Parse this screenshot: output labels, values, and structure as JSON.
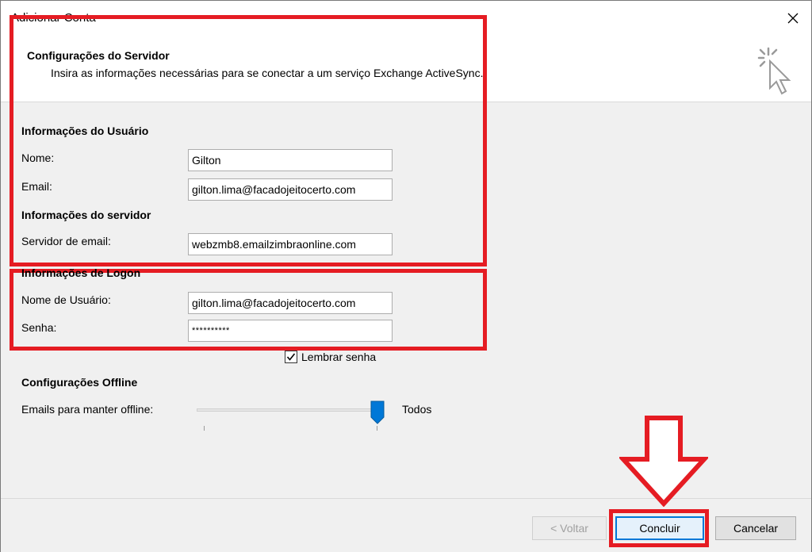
{
  "window": {
    "title": "Adicionar Conta"
  },
  "header": {
    "title": "Configurações do Servidor",
    "subtitle": "Insira as informações necessárias para se conectar a um serviço Exchange ActiveSync."
  },
  "user_info": {
    "section": "Informações do Usuário",
    "name_label": "Nome:",
    "name_value": "Gilton",
    "email_label": "Email:",
    "email_value": "gilton.lima@facadojeitocerto.com"
  },
  "server_info": {
    "section": "Informações do servidor",
    "server_label": "Servidor de email:",
    "server_value": "webzmb8.emailzimbraonline.com"
  },
  "logon_info": {
    "section": "Informações de Logon",
    "username_label": "Nome de Usuário:",
    "username_value": "gilton.lima@facadojeitocerto.com",
    "password_label": "Senha:",
    "password_value": "**********",
    "remember_label": "Lembrar senha",
    "remember_checked": true
  },
  "offline": {
    "section": "Configurações Offline",
    "keep_label": "Emails para manter offline:",
    "slider_value_label": "Todos",
    "slider_level": 1.0
  },
  "buttons": {
    "back": "< Voltar",
    "finish": "Concluir",
    "cancel": "Cancelar"
  },
  "colors": {
    "highlight_red": "#e51c23",
    "accent_blue": "#0078d7"
  }
}
